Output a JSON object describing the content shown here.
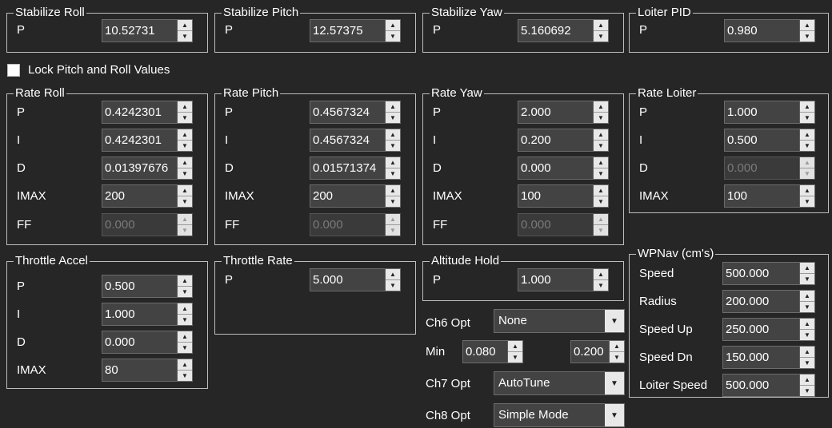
{
  "lock_label": "Lock Pitch and Roll Values",
  "groups": {
    "stab_roll": {
      "title": "Stabilize Roll",
      "p": "10.52731"
    },
    "stab_pitch": {
      "title": "Stabilize Pitch",
      "p": "12.57375"
    },
    "stab_yaw": {
      "title": "Stabilize Yaw",
      "p": "5.160692"
    },
    "loiter_pid": {
      "title": "Loiter PID",
      "p": "0.980"
    },
    "rate_roll": {
      "title": "Rate Roll",
      "p": "0.4242301",
      "i": "0.4242301",
      "d": "0.01397676",
      "imax": "200",
      "ff": "0.000"
    },
    "rate_pitch": {
      "title": "Rate Pitch",
      "p": "0.4567324",
      "i": "0.4567324",
      "d": "0.01571374",
      "imax": "200",
      "ff": "0.000"
    },
    "rate_yaw": {
      "title": "Rate Yaw",
      "p": "2.000",
      "i": "0.200",
      "d": "0.000",
      "imax": "100",
      "ff": "0.000"
    },
    "rate_loiter": {
      "title": "Rate Loiter",
      "p": "1.000",
      "i": "0.500",
      "d": "0.000",
      "imax": "100"
    },
    "throttle_accel": {
      "title": "Throttle Accel",
      "p": "0.500",
      "i": "1.000",
      "d": "0.000",
      "imax": "80"
    },
    "throttle_rate": {
      "title": "Throttle Rate",
      "p": "5.000"
    },
    "alt_hold": {
      "title": "Altitude Hold",
      "p": "1.000"
    },
    "wpnav": {
      "title": "WPNav (cm's)",
      "speed_label": "Speed",
      "speed": "500.000",
      "radius_label": "Radius",
      "radius": "200.000",
      "speed_up_label": "Speed Up",
      "speed_up": "250.000",
      "speed_dn_label": "Speed Dn",
      "speed_dn": "150.000",
      "loiter_speed_label": "Loiter Speed",
      "loiter_speed": "500.000"
    }
  },
  "labels": {
    "p": "P",
    "i": "I",
    "d": "D",
    "imax": "IMAX",
    "ff": "FF"
  },
  "ch6": {
    "label": "Ch6 Opt",
    "value": "None",
    "min_label": "Min",
    "min": "0.080",
    "max": "0.200"
  },
  "ch7": {
    "label": "Ch7 Opt",
    "value": "AutoTune"
  },
  "ch8": {
    "label": "Ch8 Opt",
    "value": "Simple Mode"
  },
  "icons": {
    "up": "▲",
    "down": "▼",
    "dropdown": "▼"
  }
}
